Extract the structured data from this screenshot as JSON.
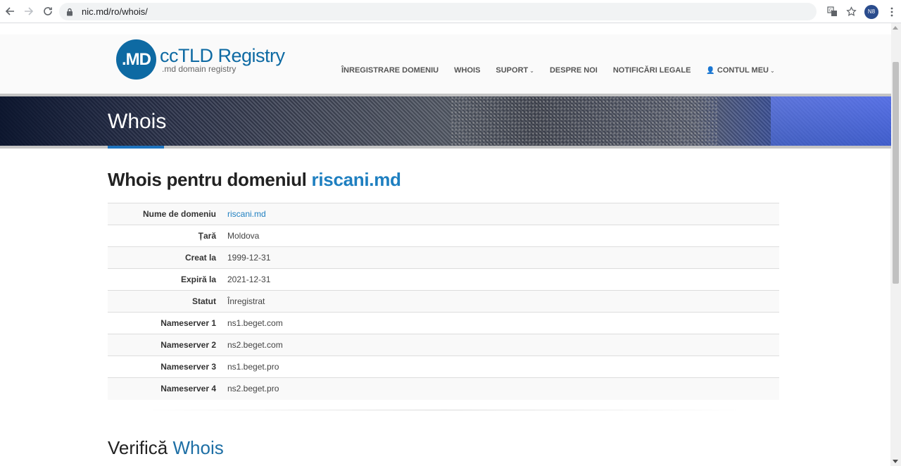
{
  "browser": {
    "url": "nic.md/ro/whois/",
    "avatar_text": "N8"
  },
  "site": {
    "logo_mark": ".MD",
    "logo_title": "ccTLD Registry",
    "logo_subtitle": ".md domain registry",
    "menu": [
      {
        "label": "ÎNREGISTRARE DOMENIU"
      },
      {
        "label": "WHOIS"
      },
      {
        "label": "SUPORT"
      },
      {
        "label": "DESPRE NOI"
      },
      {
        "label": "NOTIFICĂRI LEGALE"
      },
      {
        "label": "CONTUL MEU"
      }
    ]
  },
  "banner": {
    "title": "Whois"
  },
  "result": {
    "heading_bold": "Whois",
    "heading_middle": "pentru domeniul",
    "heading_domain": "riscani.md",
    "rows": [
      {
        "key": "Nume de domeniu",
        "value": "riscani.md"
      },
      {
        "key": "Țară",
        "value": "Moldova"
      },
      {
        "key": "Creat la",
        "value": "1999-12-31"
      },
      {
        "key": "Expiră la",
        "value": "2021-12-31"
      },
      {
        "key": "Statut",
        "value": "Înregistrat"
      },
      {
        "key": "Nameserver 1",
        "value": "ns1.beget.com"
      },
      {
        "key": "Nameserver 2",
        "value": "ns2.beget.com"
      },
      {
        "key": "Nameserver 3",
        "value": "ns1.beget.pro"
      },
      {
        "key": "Nameserver 4",
        "value": "ns2.beget.pro"
      }
    ]
  },
  "verify": {
    "word1": "Verifică",
    "word2": "Whois"
  },
  "colors": {
    "brand_blue": "#0e6aa3",
    "link_blue": "#1e7fc0"
  }
}
